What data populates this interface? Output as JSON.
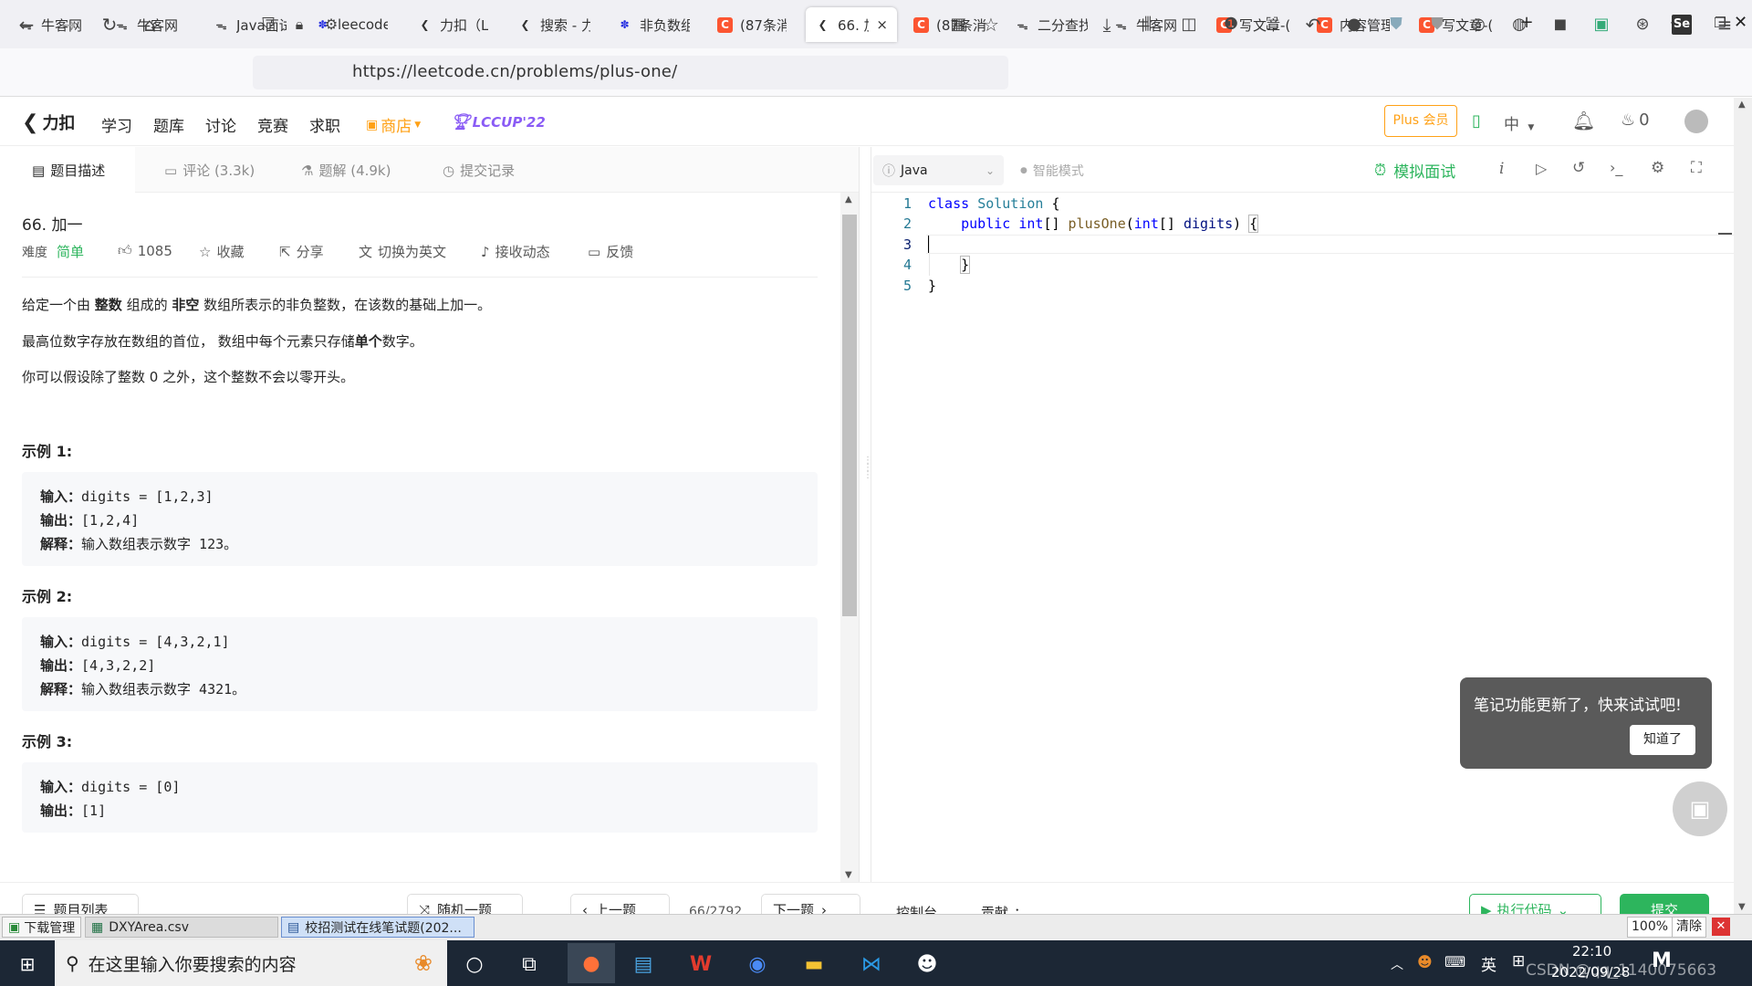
{
  "browser": {
    "tabs": [
      {
        "label": "牛客网",
        "icon": "nowcoder-icon"
      },
      {
        "label": "牛客网",
        "icon": "nowcoder-icon"
      },
      {
        "label": "Java面试",
        "icon": "nowcoder-icon"
      },
      {
        "label": "leecode",
        "icon": "baidu-paw-icon"
      },
      {
        "label": "力扣（L",
        "icon": "leetcode-icon"
      },
      {
        "label": "搜索 - 力",
        "icon": "leetcode-icon"
      },
      {
        "label": "非负数组",
        "icon": "baidu-paw-icon"
      },
      {
        "label": "(87条消",
        "icon": "csdn-icon"
      },
      {
        "label": "66. 加",
        "icon": "leetcode-icon"
      },
      {
        "label": "(87条消",
        "icon": "csdn-icon"
      },
      {
        "label": "二分查找",
        "icon": "nowcoder-icon"
      },
      {
        "label": "牛客网",
        "icon": "nowcoder-icon"
      },
      {
        "label": "写文章-(",
        "icon": "csdn-icon"
      },
      {
        "label": "内容管理",
        "icon": "csdn-icon"
      },
      {
        "label": "写文章-(",
        "icon": "csdn-icon"
      }
    ],
    "active_tab_close": "×",
    "new_tab": "+",
    "url": "https://leetcode.cn/problems/plus-one/"
  },
  "site": {
    "logo": "力扣",
    "nav": [
      "学习",
      "题库",
      "讨论",
      "竞赛",
      "求职"
    ],
    "store": "商店",
    "lccup": "LCCUP'22",
    "plus": "Plus 会员",
    "lang": "中",
    "streak": "0"
  },
  "left_tabs": [
    {
      "label": "题目描述"
    },
    {
      "label": "评论 (3.3k)"
    },
    {
      "label": "题解 (4.9k)"
    },
    {
      "label": "提交记录"
    }
  ],
  "problem": {
    "title": "66. 加一",
    "difficulty_label": "难度",
    "difficulty": "简单",
    "likes": "1085",
    "collect": "收藏",
    "share": "分享",
    "switch_lang": "切换为英文",
    "subscribe": "接收动态",
    "feedback": "反馈",
    "p1": {
      "a": "给定一个由 ",
      "b": "整数",
      "c": " 组成的 ",
      "d": "非空",
      "e": " 数组所表示的非负整数，在该数的基础上加一。"
    },
    "p2": {
      "a": "最高位数字存放在数组的首位， 数组中每个元素只存储",
      "b": "单个",
      "c": "数字。"
    },
    "p3": "你可以假设除了整数 0 之外，这个整数不会以零开头。",
    "examples": [
      {
        "title": "示例 1:",
        "in_label": "输入：",
        "in": "digits = [1,2,3]",
        "out_label": "输出：",
        "out": "[1,2,4]",
        "exp_label": "解释：",
        "exp": "输入数组表示数字 123。"
      },
      {
        "title": "示例 2:",
        "in_label": "输入：",
        "in": "digits = [4,3,2,1]",
        "out_label": "输出：",
        "out": "[4,3,2,2]",
        "exp_label": "解释：",
        "exp": "输入数组表示数字 4321。"
      },
      {
        "title": "示例 3:",
        "in_label": "输入：",
        "in": "digits = [0]",
        "out_label": "输出：",
        "out": "[1]"
      }
    ]
  },
  "editor": {
    "language": "Java",
    "smart_mode": "智能模式",
    "mock_interview": "模拟面试",
    "line_numbers": [
      "1",
      "2",
      "3",
      "4",
      "5"
    ]
  },
  "toast": {
    "message": "笔记功能更新了，快来试试吧!",
    "button": "知道了"
  },
  "bottom": {
    "problem_list": "题目列表",
    "random": "随机一题",
    "prev": "上一题",
    "pager": "66/2792",
    "next": "下一题",
    "console": "控制台",
    "contribute": "贡献",
    "run": "执行代码",
    "submit": "提交"
  },
  "downloads": {
    "manager": "下载管理",
    "file1": "DXYArea.csv",
    "file2": "校招测试在线笔试题(202...",
    "zoom": "100%",
    "clear": "清除"
  },
  "taskbar": {
    "search_placeholder": "在这里输入你要搜索的内容",
    "ime": "英",
    "time": "22:10",
    "date": "2022/09/28",
    "watermark": "CSDN @qq_1140075663"
  },
  "colors": {
    "accent_green": "#2db55d",
    "store_orange": "#ffa116",
    "lccup_purple": "#8a5cf5",
    "csdn_red": "#fc5531"
  }
}
